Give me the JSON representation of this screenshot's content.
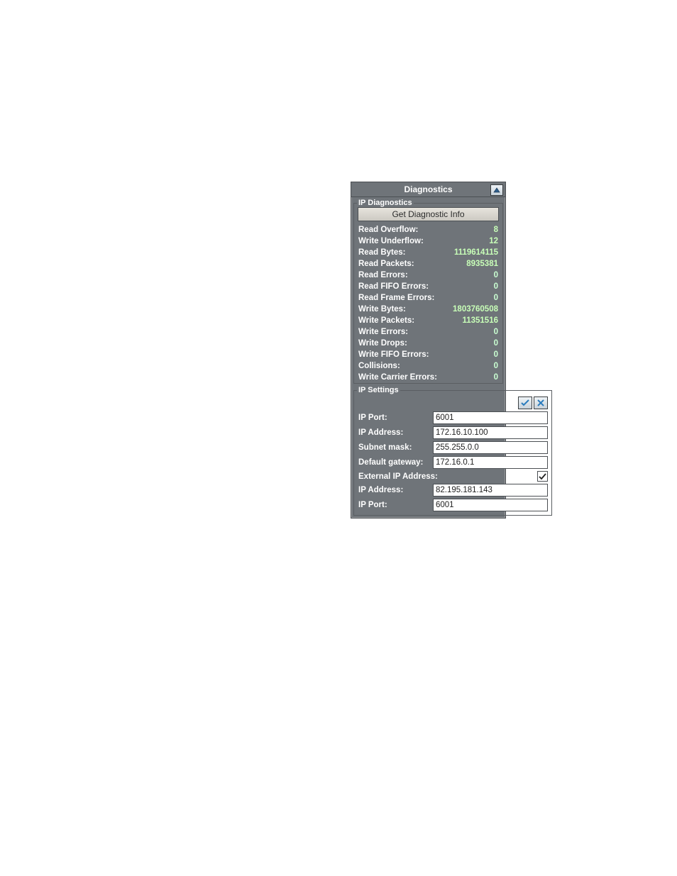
{
  "title": "Diagnostics",
  "ip_diag": {
    "legend": "IP Diagnostics",
    "button": "Get Diagnostic Info",
    "rows": [
      {
        "label": "Read Overflow:",
        "value": "8"
      },
      {
        "label": "Write Underflow:",
        "value": "12"
      },
      {
        "label": "Read Bytes:",
        "value": "1119614115"
      },
      {
        "label": "Read Packets:",
        "value": "8935381"
      },
      {
        "label": "Read Errors:",
        "value": "0"
      },
      {
        "label": "Read FIFO Errors:",
        "value": "0"
      },
      {
        "label": "Read Frame Errors:",
        "value": "0"
      },
      {
        "label": "Write Bytes:",
        "value": "1803760508"
      },
      {
        "label": "Write Packets:",
        "value": "11351516"
      },
      {
        "label": "Write Errors:",
        "value": "0"
      },
      {
        "label": "Write Drops:",
        "value": "0"
      },
      {
        "label": "Write FIFO Errors:",
        "value": "0"
      },
      {
        "label": "Collisions:",
        "value": "0"
      },
      {
        "label": "Write Carrier Errors:",
        "value": "0"
      }
    ]
  },
  "ip_settings": {
    "legend": "IP Settings",
    "ip_port_label": "IP Port:",
    "ip_port": "6001",
    "ip_addr_label": "IP Address:",
    "ip_addr": "172.16.10.100",
    "subnet_label": "Subnet mask:",
    "subnet": "255.255.0.0",
    "gateway_label": "Default gateway:",
    "gateway": "172.16.0.1",
    "ext_label": "External IP Address:",
    "ext_checked": true,
    "ext_ip_label": "IP Address:",
    "ext_ip": "82.195.181.143",
    "ext_port_label": "IP Port:",
    "ext_port": "6001"
  }
}
